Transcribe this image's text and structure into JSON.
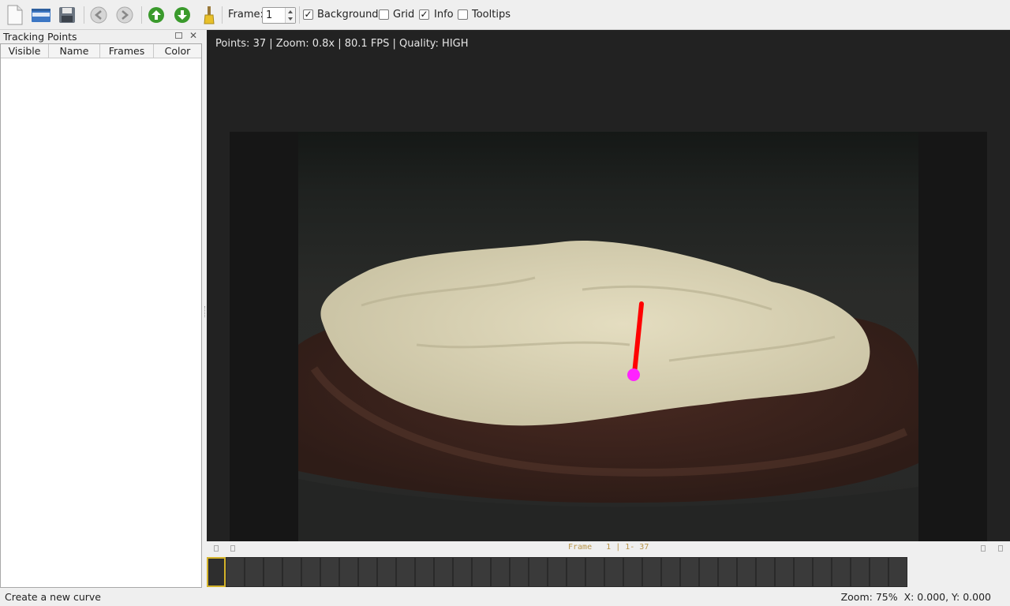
{
  "toolbar": {
    "icons": [
      "new-file-icon",
      "open-folder-icon",
      "save-icon",
      "undo-icon",
      "redo-icon",
      "prev-point-icon",
      "next-point-icon",
      "brush-icon"
    ],
    "frame_label": "Frame:",
    "frame_value": "1",
    "checkboxes": [
      {
        "label": "Background",
        "checked": true
      },
      {
        "label": "Grid",
        "checked": false
      },
      {
        "label": "Info",
        "checked": true
      },
      {
        "label": "Tooltips",
        "checked": false
      }
    ],
    "check_mark": "✓"
  },
  "panel": {
    "title": "Tracking Points",
    "columns": [
      "Visible",
      "Name",
      "Frames",
      "Color"
    ],
    "rows": []
  },
  "viewer": {
    "info": "Points: 37 | Zoom: 0.8x | 80.1 FPS | Quality: HIGH",
    "track_color": "#ff0000",
    "point_color": "#ff22ff"
  },
  "timeline": {
    "caption": "Frame   1 | 1- 37",
    "frame_count": 37,
    "current_frame": 1,
    "accent": "#d4b32a"
  },
  "status": {
    "message": "Create a new curve",
    "zoom": "Zoom: 75%",
    "coords": "X: 0.000, Y: 0.000"
  }
}
